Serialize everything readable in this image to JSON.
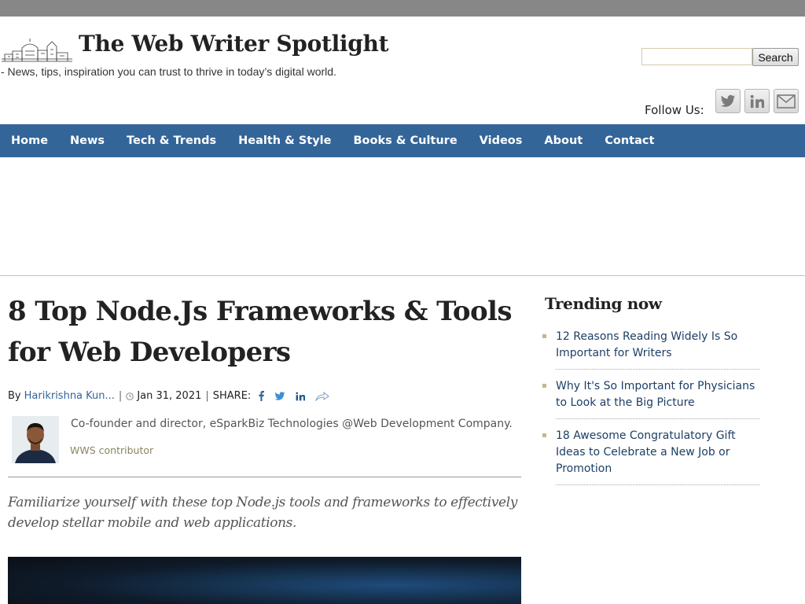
{
  "header": {
    "site_title": "The Web Writer Spotlight",
    "tagline": "- News, tips, inspiration you can trust to thrive in today’s digital world.",
    "search": {
      "placeholder": "",
      "button_label": "Search"
    },
    "follow_label": "Follow Us:",
    "social_icons": [
      "twitter-icon",
      "linkedin-icon",
      "mail-icon"
    ]
  },
  "nav": {
    "items": [
      {
        "label": "Home"
      },
      {
        "label": "News"
      },
      {
        "label": "Tech & Trends"
      },
      {
        "label": "Health & Style"
      },
      {
        "label": "Books & Culture"
      },
      {
        "label": "Videos"
      },
      {
        "label": "About"
      },
      {
        "label": "Contact"
      }
    ]
  },
  "article": {
    "title": "8 Top Node.Js Frameworks & Tools for Web Developers",
    "by_label": "By",
    "author": "Harikrishna Kun...",
    "date": "Jan 31, 2021",
    "share_label": "SHARE:",
    "share_icons": [
      "facebook-icon",
      "twitter-icon",
      "linkedin-icon",
      "share-icon"
    ],
    "author_bio": "Co-founder and director, eSparkBiz Technologies @Web Development Company.",
    "author_role": "WWS contributor",
    "dek": "Familiarize yourself with these top Node.js tools and frameworks to effectively develop stellar mobile and web applications."
  },
  "sidebar": {
    "trending_title": "Trending now",
    "items": [
      {
        "label": "12 Reasons Reading Widely Is So Important for Writers"
      },
      {
        "label": "Why It's So Important for Physicians to Look at the Big Picture"
      },
      {
        "label": "18 Awesome Congratulatory Gift Ideas to Celebrate a New Job or Promotion"
      }
    ]
  },
  "colors": {
    "nav_bg": "#336599",
    "link": "#336599",
    "top_strip": "#888787",
    "bullet": "#c6b68a"
  }
}
